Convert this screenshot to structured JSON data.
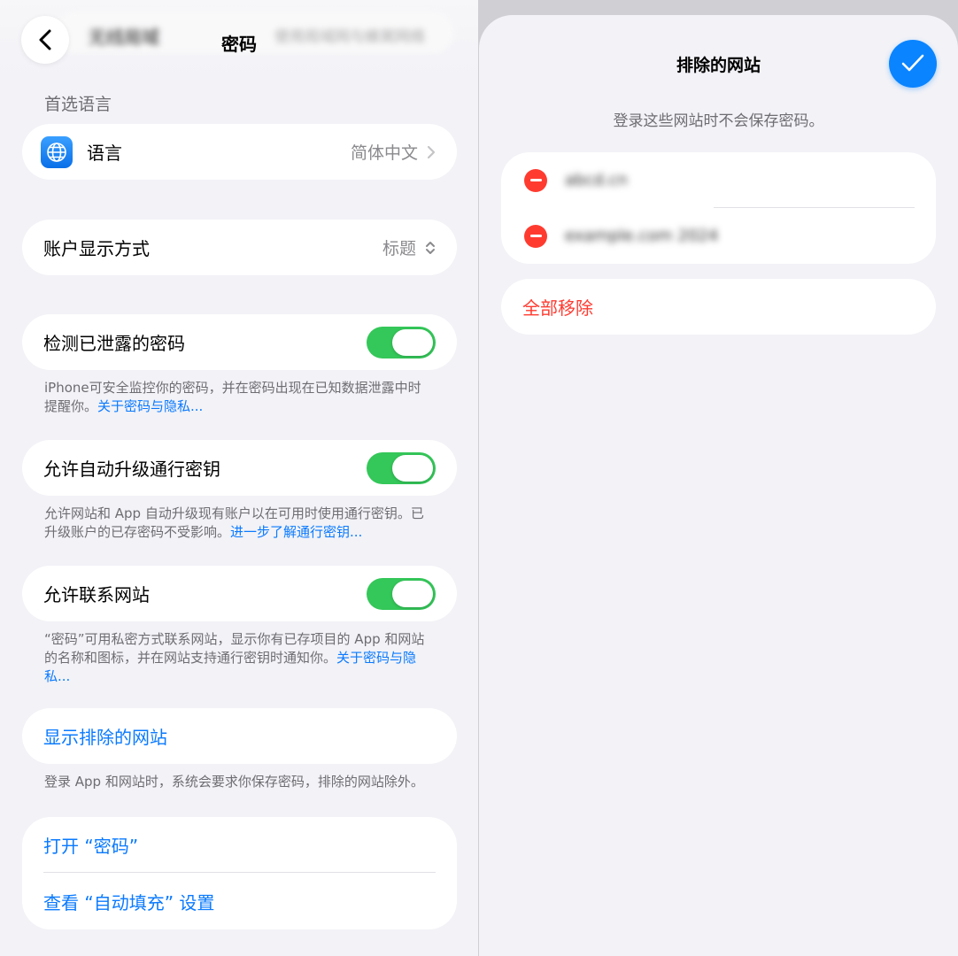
{
  "left": {
    "nav": {
      "title": "密码",
      "blurred_row_label": "无线局域",
      "blurred_row_value": "使用局域网与蜂窝网络"
    },
    "language_section": {
      "header": "首选语言",
      "language_label": "语言",
      "language_value": "简体中文"
    },
    "account_display": {
      "label": "账户显示方式",
      "value": "标题"
    },
    "detect_compromised": {
      "label": "检测已泄露的密码",
      "toggle_on": true,
      "footer_text": "iPhone可安全监控你的密码，并在密码出现在已知数据泄露中时提醒你。",
      "footer_link": "关于密码与隐私..."
    },
    "auto_upgrade": {
      "label": "允许自动升级通行密钥",
      "toggle_on": true,
      "footer_text": "允许网站和 App 自动升级现有账户以在可用时使用通行密钥。已升级账户的已存密码不受影响。",
      "footer_link": "进一步了解通行密钥..."
    },
    "contact_websites": {
      "label": "允许联系网站",
      "toggle_on": true,
      "footer_text": "“密码”可用私密方式联系网站，显示你有已存项目的 App 和网站的名称和图标，并在网站支持通行密钥时通知你。",
      "footer_link": "关于密码与隐私..."
    },
    "show_excluded": {
      "label": "显示排除的网站",
      "footer_text": "登录 App 和网站时，系统会要求你保存密码，排除的网站除外。"
    },
    "links": {
      "open_passwords": "打开 “密码”",
      "view_autofill": "查看 “自动填充” 设置"
    }
  },
  "right": {
    "title": "排除的网站",
    "description": "登录这些网站时不会保存密码。",
    "sites": [
      {
        "name": "abcd.cn"
      },
      {
        "name": "example.com 2024"
      }
    ],
    "remove_all": "全部移除"
  },
  "colors": {
    "accent": "#0a7aff",
    "toggle_on": "#34c759",
    "destructive": "#ff3b30",
    "background": "#f2f2f7"
  }
}
